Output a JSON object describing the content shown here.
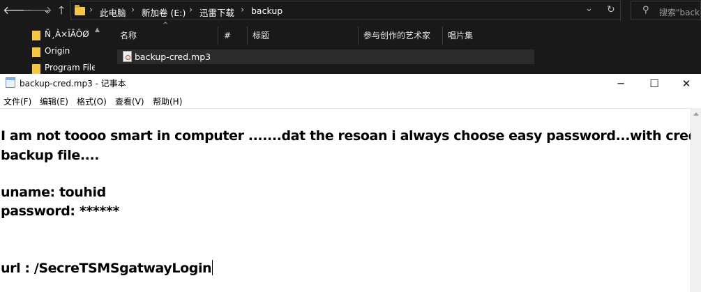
{
  "explorer": {
    "breadcrumbs": [
      "此电脑",
      "新加卷 (E:)",
      "迅雷下载",
      "backup"
    ],
    "search_placeholder": "搜索\"back",
    "tree_items": [
      "Ñ¸À×ÏÂÔØ",
      "Origin",
      "Program File"
    ],
    "columns": [
      "名称",
      "#",
      "标题",
      "参与创作的艺术家",
      "唱片集"
    ],
    "file_name": "backup-cred.mp3"
  },
  "notepad": {
    "title": "backup-cred.mp3 - 记事本",
    "menu": [
      "文件(F)",
      "编辑(E)",
      "格式(O)",
      "查看(V)",
      "帮助(H)"
    ],
    "lines": [
      "I am not toooo smart in computer .......dat the resoan i always choose easy password...with creds",
      "backup file....",
      "uname: touhid",
      "password: ******",
      "url : /SecreTSMSgatwayLogin"
    ]
  }
}
